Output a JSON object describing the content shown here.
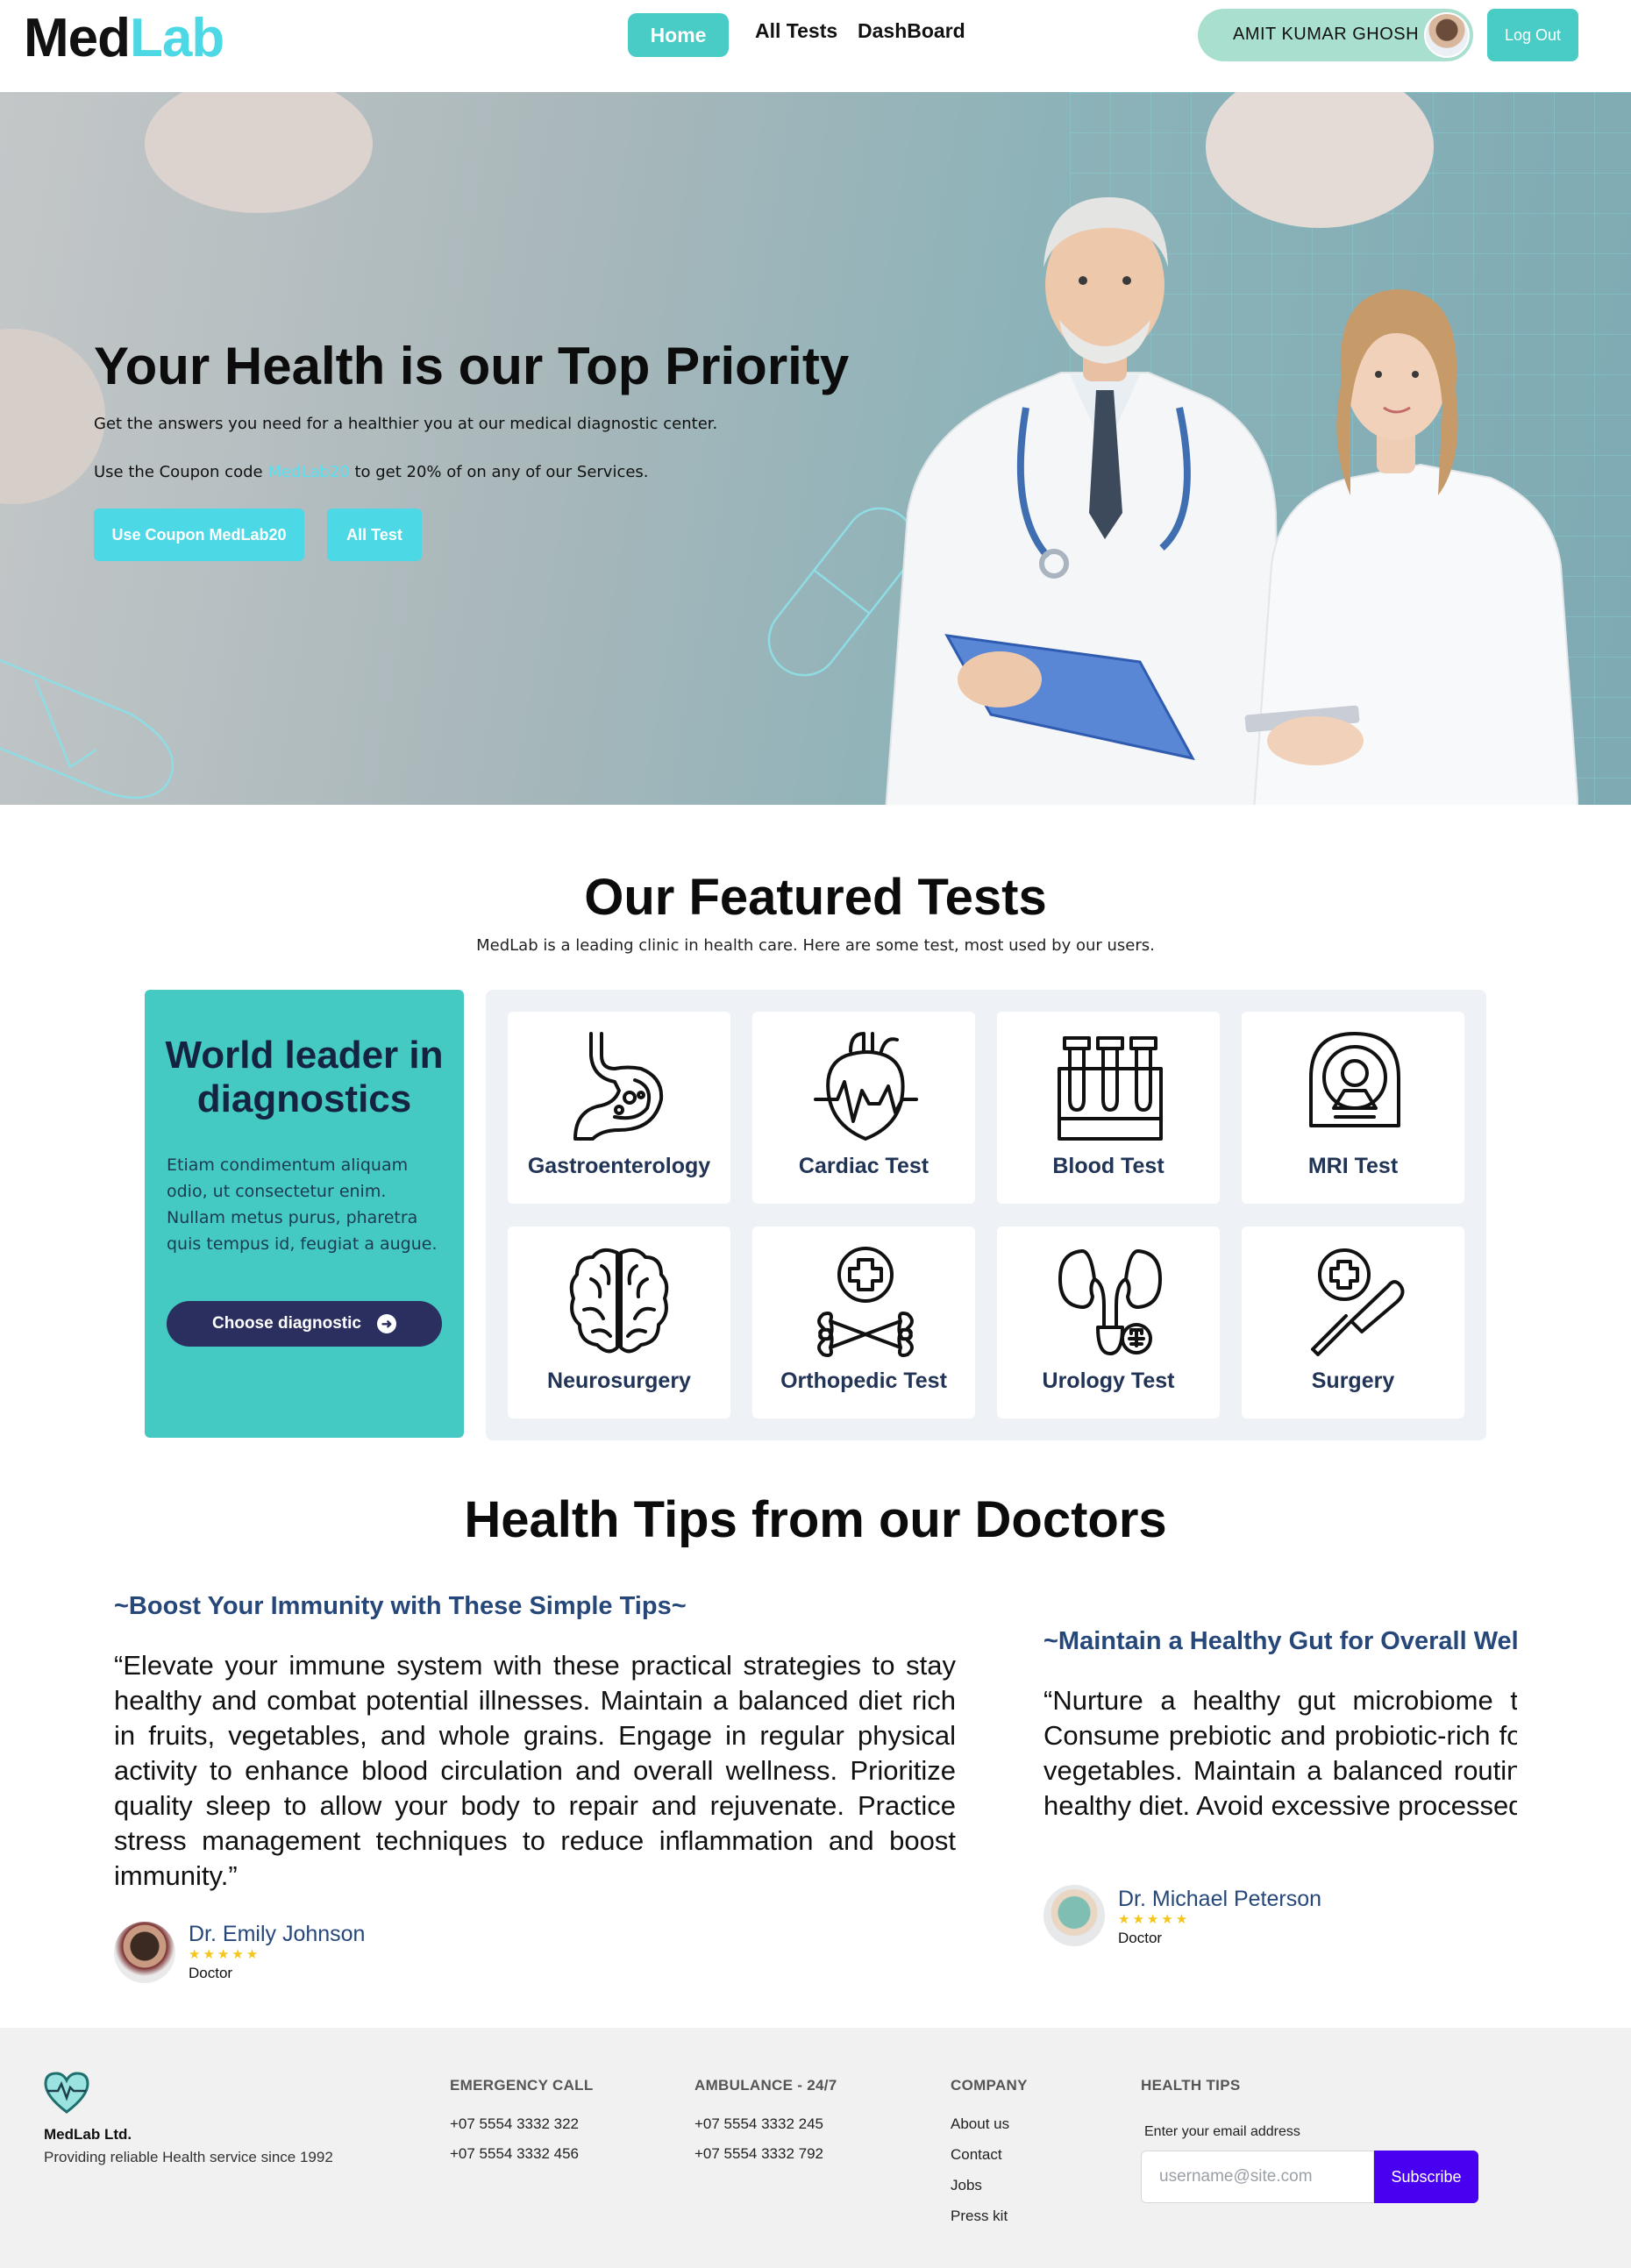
{
  "nav": {
    "logo_med": "Med",
    "logo_lab": "Lab",
    "home": "Home",
    "all_tests": "All Tests",
    "dashboard": "DashBoard",
    "user_name": "AMIT KUMAR GHOSH",
    "logout": "Log Out"
  },
  "hero": {
    "title": "Your Health is our Top Priority",
    "subtitle": "Get the answers you need for a healthier you at our medical diagnostic center.",
    "coupon_prefix": "Use the Coupon code ",
    "coupon_code": "MedLab20",
    "coupon_suffix": " to get 20% of on any of our Services.",
    "btn_coupon": "Use Coupon MedLab20",
    "btn_all": "All Test"
  },
  "featured": {
    "title": "Our Featured Tests",
    "subtitle": "MedLab is a leading clinic in health care. Here are some test, most used by our users.",
    "promo_title": "World leader in diagnostics",
    "promo_text": "Etiam condimentum aliquam odio, ut consectetur enim. Nullam metus purus, pharetra quis tempus id, feugiat a augue.",
    "promo_button": "Choose diagnostic",
    "tests": [
      {
        "label": "Gastroenterology",
        "icon": "stomach-icon"
      },
      {
        "label": "Cardiac Test",
        "icon": "heart-icon"
      },
      {
        "label": "Blood Test",
        "icon": "test-tubes-icon"
      },
      {
        "label": "MRI Test",
        "icon": "mri-scanner-icon"
      },
      {
        "label": "Neurosurgery",
        "icon": "brain-icon"
      },
      {
        "label": "Orthopedic Test",
        "icon": "bone-icon"
      },
      {
        "label": "Urology Test",
        "icon": "kidney-icon"
      },
      {
        "label": "Surgery",
        "icon": "scalpel-icon"
      }
    ]
  },
  "tips": {
    "title": "Health Tips from our Doctors",
    "items": [
      {
        "title": "~Boost Your Immunity with These Simple Tips~",
        "body": "“Elevate your immune system with these practical strategies to stay healthy and combat potential illnesses. Maintain a balanced diet rich in fruits, vegetables, and whole grains. Engage in regular physical activity to enhance blood circulation and overall wellness. Prioritize quality sleep to allow your body to repair and rejuvenate. Practice stress management techniques to reduce inflammation and boost immunity.”",
        "author": "Dr. Emily Johnson",
        "stars": "★★★★★",
        "role": "Doctor"
      },
      {
        "title": "~Maintain a Healthy Gut for Overall Well-being~",
        "body": "“Nurture a healthy gut microbiome to support overall well-being. Consume prebiotic and probiotic-rich foods like yogurt and fermented vegetables. Maintain a balanced routine with regular exercise and a healthy diet. Avoid excessive processed foods and sugary drinks.”",
        "author": "Dr. Michael Peterson",
        "stars": "★★★★★",
        "role": "Doctor"
      }
    ]
  },
  "footer": {
    "brand": "MedLab Ltd.",
    "tagline": "Providing reliable Health service since 1992",
    "emergency_head": "EMERGENCY CALL",
    "emergency": [
      "+07 5554 3332 322",
      "+07 5554 3332 456"
    ],
    "ambulance_head": "AMBULANCE - 24/7",
    "ambulance": [
      "+07 5554 3332 245",
      "+07 5554 3332 792"
    ],
    "company_head": "COMPANY",
    "company": [
      "About us",
      "Contact",
      "Jobs",
      "Press kit"
    ],
    "tips_head": "HEALTH TIPS",
    "email_label": "Enter your email address",
    "email_placeholder": "username@site.com",
    "subscribe": "Subscribe"
  },
  "colors": {
    "accent": "#49cbc6",
    "cyan": "#4dd8e6",
    "navy": "#2b2f5f",
    "subscribe": "#4a00f0"
  }
}
